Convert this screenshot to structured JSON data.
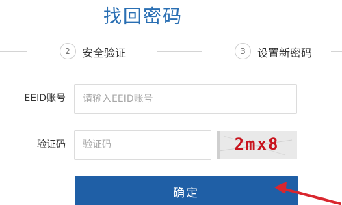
{
  "page": {
    "title": "找回密码"
  },
  "steps": [
    {
      "number": "2",
      "label": "安全验证"
    },
    {
      "number": "3",
      "label": "设置新密码"
    }
  ],
  "form": {
    "account": {
      "label": "EEID账号",
      "placeholder": "请输入EEID账号"
    },
    "captcha": {
      "label": "验证码",
      "placeholder": "验证码",
      "image_text": "2mx8"
    },
    "submit_label": "确定"
  },
  "colors": {
    "accent": "#1f5fa6",
    "title": "#2a6fb3",
    "captcha_text": "#c8141e",
    "arrow": "#d9262e"
  }
}
